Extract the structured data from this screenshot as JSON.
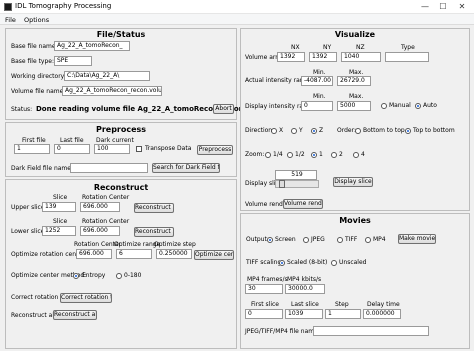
{
  "window": {
    "title": "IDL Tomography Processing",
    "min": "—",
    "max": "☐",
    "close": "✕"
  },
  "menu": {
    "file": "File",
    "options": "Options"
  },
  "file_status": {
    "title": "File/Status",
    "base_name_label": "Base file name:",
    "base_name_value": "Ag_22_A_tomoRecon_",
    "base_type_label": "Base file type:",
    "base_type_value": "SPE",
    "working_dir_label": "Working directory:",
    "working_dir_value": "C:\\Data\\Ag_22_A\\",
    "volume_label": "Volume file name:",
    "volume_value": "Ag_22_A_tomoRecon_recon.volume",
    "status_label": "Status:",
    "status_value": "Done reading volume file Ag_22_A_tomoRecon_recon.v",
    "abort_label": "Abort"
  },
  "preprocess": {
    "title": "Preprocess",
    "first_file_label": "First file",
    "first_file_value": "1",
    "last_file_label": "Last file",
    "last_file_value": "0",
    "dark_current_label": "Dark current",
    "dark_current_value": "100",
    "transpose_label": "Transpose Data",
    "preprocess_button": "Preprocess",
    "dark_field_label": "Dark Field file name:",
    "dark_field_value": "",
    "search_dark_button": "Search for Dark Field file"
  },
  "reconstruct": {
    "title": "Reconstruct",
    "slice_header": "Slice",
    "rot_center_header": "Rotation Center",
    "upper_label": "Upper slice:",
    "upper_slice": "139",
    "upper_center": "696.000",
    "reconstruct_slice_label": "Reconstruct slice",
    "lower_label": "Lower slice:",
    "lower_slice": "1252",
    "lower_center": "696.000",
    "rot_center_header2": "Rotation Center",
    "opt_range_header": "Optimize range",
    "opt_step_header": "Optimize step",
    "opt_rot_label": "Optimize rotation center:",
    "opt_center_value": "696.000",
    "opt_range_value": "6",
    "opt_step_value": "0.250000",
    "optimize_center_button": "Optimize center",
    "opt_method_label": "Optimize center method:",
    "entropy_label": "Entropy",
    "range_label": "0-180",
    "correct_tilt_label": "Correct rotation tilt:",
    "correct_tilt_button": "Correct rotation tilt",
    "reconstruct_all_label": "Reconstruct all:",
    "reconstruct_all_button": "Reconstruct all"
  },
  "visualize": {
    "title": "Visualize",
    "nx_header": "NX",
    "ny_header": "NY",
    "nz_header": "NZ",
    "type_header": "Type",
    "volume_array_label": "Volume array:",
    "nx": "1392",
    "ny": "1392",
    "nz": "1040",
    "type": "",
    "min_header": "Min.",
    "max_header": "Max.",
    "actual_range_label": "Actual intensity range:",
    "actual_min": "-4087.00",
    "actual_max": "26729.0",
    "display_range_label": "Display intensity range:",
    "display_min": "0",
    "display_max": "5000",
    "manual_label": "Manual",
    "auto_label": "Auto",
    "direction_label": "Direction:",
    "dir_x": "X",
    "dir_y": "Y",
    "dir_z": "Z",
    "order_label": "Order:",
    "bottom_to_top": "Bottom to top",
    "top_to_bottom": "Top to bottom",
    "zoom_label": "Zoom:",
    "zoom_14": "1/4",
    "zoom_12": "1/2",
    "zoom_1": "1",
    "zoom_2": "2",
    "zoom_4": "4",
    "display_slice_label": "Display slice:",
    "display_slice_value": "519",
    "display_slice_button": "Display slice",
    "volume_render_label": "Volume render:",
    "volume_render_button": "Volume render"
  },
  "movies": {
    "title": "Movies",
    "output_label": "Output:",
    "screen": "Screen",
    "jpeg": "JPEG",
    "tiff": "TIFF",
    "mp4": "MP4",
    "make_movie_button": "Make movie",
    "tiff_scaling_label": "TIFF scaling:",
    "scaled_label": "Scaled (8-bit)",
    "unscaled_label": "Unscaled",
    "fps_label": "MP4 frames/s",
    "fps_value": "30",
    "kbits_label": "MP4 kbits/s",
    "kbits_value": "30000.0",
    "first_slice_label": "First slice",
    "first_slice_value": "0",
    "last_slice_label": "Last slice",
    "last_slice_value": "1039",
    "step_label": "Step",
    "step_value": "1",
    "delay_label": "Delay time",
    "delay_value": "0.000000",
    "file_label": "JPEG/TIFF/MP4 file name:",
    "file_value": ""
  }
}
